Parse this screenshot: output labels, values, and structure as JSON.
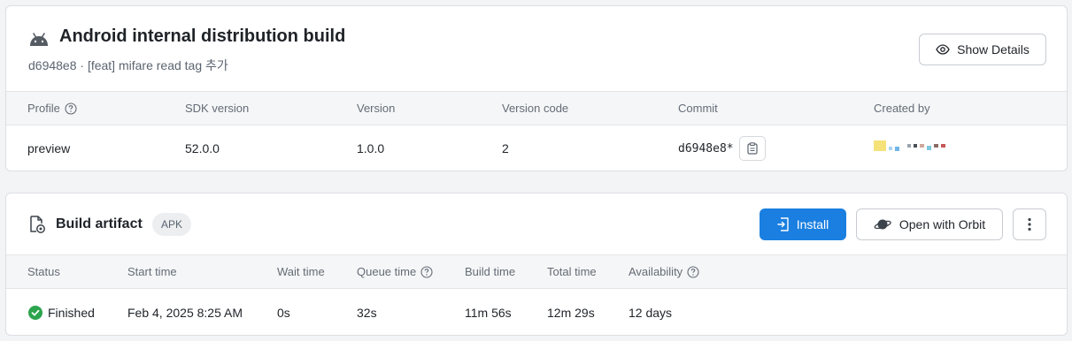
{
  "build_header": {
    "title": "Android internal distribution build",
    "subtitle": "d6948e8 · [feat] mifare read tag 추가",
    "show_details_label": "Show Details",
    "icon": "android-icon"
  },
  "build_table": {
    "headers": {
      "profile": "Profile",
      "sdk_version": "SDK version",
      "version": "Version",
      "version_code": "Version code",
      "commit": "Commit",
      "created_by": "Created by"
    },
    "row": {
      "profile": "preview",
      "sdk_version": "52.0.0",
      "version": "1.0.0",
      "version_code": "2",
      "commit": "d6948e8*"
    }
  },
  "artifact": {
    "title": "Build artifact",
    "badge": "APK",
    "install_label": "Install",
    "orbit_label": "Open with Orbit",
    "more_icon": "kebab-menu-icon",
    "install_color": "#1a7fe0"
  },
  "artifact_table": {
    "headers": {
      "status": "Status",
      "start_time": "Start time",
      "wait_time": "Wait time",
      "queue_time": "Queue time",
      "build_time": "Build time",
      "total_time": "Total time",
      "availability": "Availability"
    },
    "row": {
      "status": "Finished",
      "start_time": "Feb 4, 2025 8:25 AM",
      "wait_time": "0s",
      "queue_time": "32s",
      "build_time": "11m 56s",
      "total_time": "12m 29s",
      "availability": "12 days"
    },
    "status_color": "#2da44e"
  }
}
